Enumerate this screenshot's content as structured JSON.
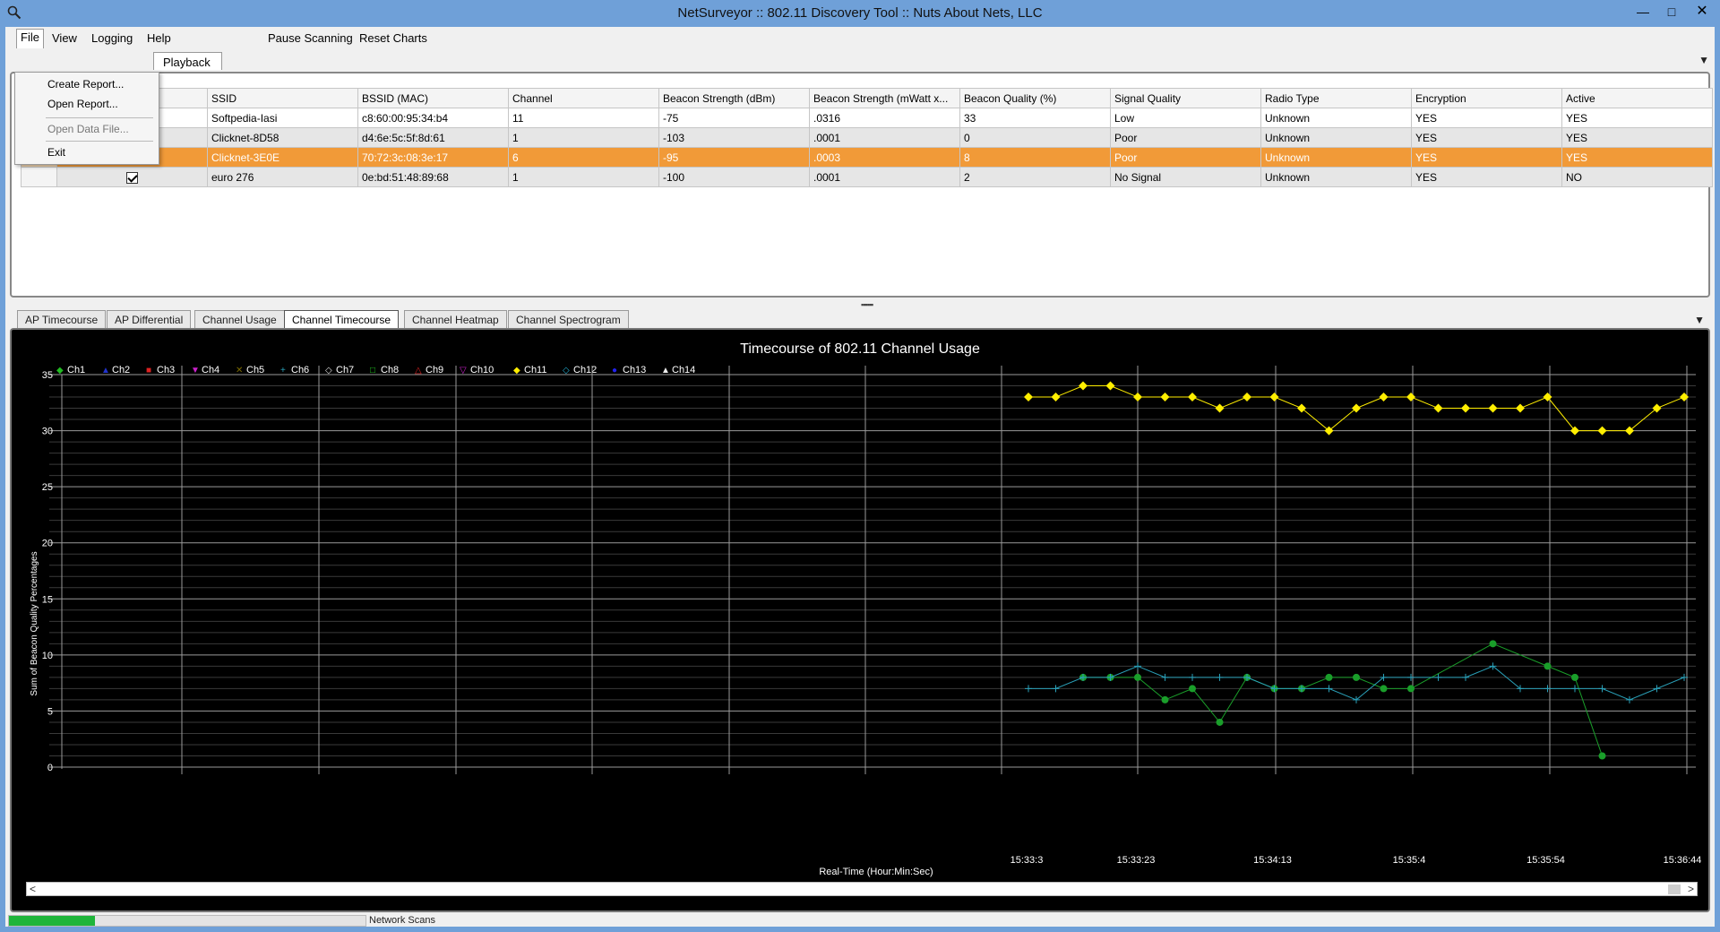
{
  "window": {
    "title": "NetSurveyor :: 802.11 Discovery Tool :: Nuts About Nets, LLC",
    "controls": {
      "minimize": "—",
      "maximize": "□",
      "close": "✕"
    }
  },
  "menu": {
    "items": [
      "File",
      "View",
      "Logging",
      "Help",
      "Pause Scanning",
      "Reset Charts"
    ],
    "file_dropdown": [
      "Create Report...",
      "Open Report...",
      "Open Data File...",
      "Exit"
    ]
  },
  "top_tabs": {
    "visible_tab": "Playback"
  },
  "ap_table": {
    "columns": [
      "SSID",
      "BSSID (MAC)",
      "Channel",
      "Beacon Strength (dBm)",
      "Beacon Strength  (mWatt x...",
      "Beacon Quality (%)",
      "Signal Quality",
      "Radio Type",
      "Encryption",
      "Active"
    ],
    "rows": [
      {
        "checked": true,
        "ssid": "Softpedia-Iasi",
        "bssid": "c8:60:00:95:34:b4",
        "channel": "11",
        "dbm": "-75",
        "mwatt": ".0316",
        "quality": "33",
        "signal": "Low",
        "radio": "Unknown",
        "enc": "YES",
        "active": "YES"
      },
      {
        "checked": true,
        "ssid": "Clicknet-8D58",
        "bssid": "d4:6e:5c:5f:8d:61",
        "channel": "1",
        "dbm": "-103",
        "mwatt": ".0001",
        "quality": "0",
        "signal": "Poor",
        "radio": "Unknown",
        "enc": "YES",
        "active": "YES"
      },
      {
        "checked": true,
        "ssid": "Clicknet-3E0E",
        "bssid": "70:72:3c:08:3e:17",
        "channel": "6",
        "dbm": "-95",
        "mwatt": ".0003",
        "quality": "8",
        "signal": "Poor",
        "radio": "Unknown",
        "enc": "YES",
        "active": "YES"
      },
      {
        "checked": true,
        "ssid": "euro 276",
        "bssid": "0e:bd:51:48:89:68",
        "channel": "1",
        "dbm": "-100",
        "mwatt": ".0001",
        "quality": "2",
        "signal": "No Signal",
        "radio": "Unknown",
        "enc": "YES",
        "active": "NO"
      }
    ],
    "selected_row": 2
  },
  "lower_tabs": {
    "items": [
      "AP Timecourse",
      "AP Differential",
      "Channel Usage",
      "Channel Timecourse",
      "Channel Heatmap",
      "Channel Spectrogram"
    ],
    "active": "Channel Timecourse"
  },
  "status": {
    "label": "Network Scans",
    "progress": 0.24
  },
  "colors": {
    "selection": "#f19a38",
    "chart_bg": "#000000",
    "ch1": "#1a9e2a",
    "ch6": "#2aa0b8",
    "ch11": "#ffee00",
    "progress": "#1fb53a"
  },
  "chart_data": {
    "type": "line",
    "title": "Timecourse of 802.11 Channel Usage",
    "xlabel": "Real-Time (Hour:Min:Sec)",
    "ylabel": "Sum of Beacon Quality Percentages",
    "ylim": [
      0,
      35
    ],
    "yticks": [
      0,
      5,
      10,
      15,
      20,
      25,
      30,
      35
    ],
    "grid": true,
    "legend_position": "top-left",
    "x_tick_labels": [
      "15:33:3",
      "15:33:23",
      "15:34:13",
      "15:35:4",
      "15:35:54",
      "15:36:44"
    ],
    "x_tick_index": [
      0,
      4,
      9,
      14,
      19,
      24
    ],
    "legend": [
      {
        "name": "Ch1",
        "symbol": "◆",
        "color": "#22bb22"
      },
      {
        "name": "Ch2",
        "symbol": "▲",
        "color": "#2233cc"
      },
      {
        "name": "Ch3",
        "symbol": "■",
        "color": "#dd2222"
      },
      {
        "name": "Ch4",
        "symbol": "▼",
        "color": "#cc22cc"
      },
      {
        "name": "Ch5",
        "symbol": "✕",
        "color": "#7a6a00"
      },
      {
        "name": "Ch6",
        "symbol": "+",
        "color": "#2aa0b8"
      },
      {
        "name": "Ch7",
        "symbol": "◇",
        "color": "#dddddd"
      },
      {
        "name": "Ch8",
        "symbol": "□",
        "color": "#22cc22"
      },
      {
        "name": "Ch9",
        "symbol": "△",
        "color": "#dd2222"
      },
      {
        "name": "Ch10",
        "symbol": "▽",
        "color": "#cc22cc"
      },
      {
        "name": "Ch11",
        "symbol": "◆",
        "color": "#ffee00"
      },
      {
        "name": "Ch12",
        "symbol": "◇",
        "color": "#22aacc"
      },
      {
        "name": "Ch13",
        "symbol": "●",
        "color": "#2222ee"
      },
      {
        "name": "Ch14",
        "symbol": "▲",
        "color": "#eeeeee"
      }
    ],
    "series": [
      {
        "name": "Ch11",
        "marker": "diamond",
        "color": "#ffee00",
        "values": [
          33,
          33,
          34,
          34,
          33,
          33,
          33,
          32,
          33,
          33,
          32,
          30,
          32,
          33,
          33,
          32,
          32,
          32,
          32,
          33,
          30,
          30,
          30,
          32,
          33
        ]
      },
      {
        "name": "Ch1",
        "marker": "circle",
        "color": "#1a9e2a",
        "values": [
          null,
          null,
          8,
          8,
          8,
          6,
          7,
          4,
          8,
          7,
          7,
          8,
          8,
          7,
          7,
          null,
          null,
          11,
          null,
          9,
          8,
          1,
          null,
          null,
          null
        ]
      },
      {
        "name": "Ch6",
        "marker": "plus",
        "color": "#2aa0b8",
        "values": [
          7,
          7,
          8,
          8,
          9,
          8,
          8,
          8,
          8,
          7,
          7,
          7,
          6,
          8,
          8,
          8,
          8,
          9,
          7,
          7,
          7,
          7,
          6,
          7,
          8
        ]
      }
    ]
  }
}
